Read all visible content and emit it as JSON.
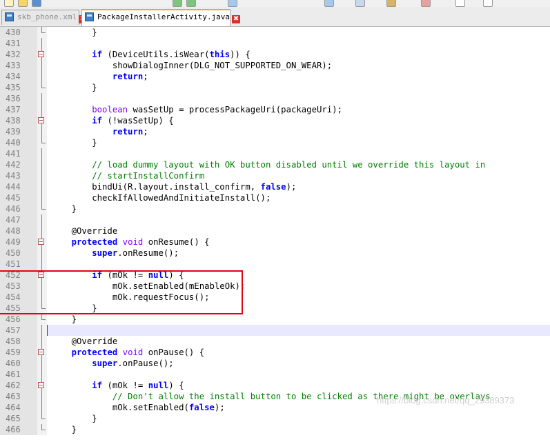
{
  "tabs": [
    {
      "label": "skb_phone.xml",
      "active": false
    },
    {
      "label": "PackageInstallerActivity.java",
      "active": true
    }
  ],
  "close_symbol": "✖",
  "lines": [
    {
      "n": "430",
      "fold": "end",
      "segs": [
        [
          "        }",
          ""
        ]
      ]
    },
    {
      "n": "431",
      "fold": "bar",
      "segs": []
    },
    {
      "n": "432",
      "fold": "open",
      "segs": [
        [
          "        ",
          ""
        ],
        [
          "if",
          "kw"
        ],
        [
          " (DeviceUtils.isWear(",
          ""
        ],
        [
          "this",
          "kw"
        ],
        [
          ")) {",
          ""
        ]
      ]
    },
    {
      "n": "433",
      "fold": "bar",
      "segs": [
        [
          "            showDialogInner(DLG_NOT_SUPPORTED_ON_WEAR);",
          ""
        ]
      ]
    },
    {
      "n": "434",
      "fold": "bar",
      "segs": [
        [
          "            ",
          ""
        ],
        [
          "return",
          "kw"
        ],
        [
          ";",
          ""
        ]
      ]
    },
    {
      "n": "435",
      "fold": "end",
      "segs": [
        [
          "        }",
          ""
        ]
      ]
    },
    {
      "n": "436",
      "fold": "bar",
      "segs": []
    },
    {
      "n": "437",
      "fold": "bar",
      "segs": [
        [
          "        ",
          ""
        ],
        [
          "boolean",
          "ty"
        ],
        [
          " wasSetUp = processPackageUri(packageUri);",
          ""
        ]
      ]
    },
    {
      "n": "438",
      "fold": "open",
      "segs": [
        [
          "        ",
          ""
        ],
        [
          "if",
          "kw"
        ],
        [
          " (!wasSetUp) {",
          ""
        ]
      ]
    },
    {
      "n": "439",
      "fold": "bar",
      "segs": [
        [
          "            ",
          ""
        ],
        [
          "return",
          "kw"
        ],
        [
          ";",
          ""
        ]
      ]
    },
    {
      "n": "440",
      "fold": "end",
      "segs": [
        [
          "        }",
          ""
        ]
      ]
    },
    {
      "n": "441",
      "fold": "bar",
      "segs": []
    },
    {
      "n": "442",
      "fold": "bar",
      "segs": [
        [
          "        // load dummy layout with OK button disabled until we override this layout in",
          "cm"
        ]
      ]
    },
    {
      "n": "443",
      "fold": "bar",
      "segs": [
        [
          "        // startInstallConfirm",
          "cm"
        ]
      ]
    },
    {
      "n": "444",
      "fold": "bar",
      "segs": [
        [
          "        bindUi(R.layout.install_confirm, ",
          ""
        ],
        [
          "false",
          "kw"
        ],
        [
          ");",
          ""
        ]
      ]
    },
    {
      "n": "445",
      "fold": "bar",
      "segs": [
        [
          "        checkIfAllowedAndInitiateInstall();",
          ""
        ]
      ]
    },
    {
      "n": "446",
      "fold": "end",
      "segs": [
        [
          "    }",
          ""
        ]
      ]
    },
    {
      "n": "447",
      "fold": "bar",
      "segs": []
    },
    {
      "n": "448",
      "fold": "bar",
      "segs": [
        [
          "    @Override",
          ""
        ]
      ]
    },
    {
      "n": "449",
      "fold": "open",
      "segs": [
        [
          "    ",
          ""
        ],
        [
          "protected",
          "kw"
        ],
        [
          " ",
          ""
        ],
        [
          "void",
          "ty"
        ],
        [
          " onResume() {",
          ""
        ]
      ]
    },
    {
      "n": "450",
      "fold": "bar",
      "segs": [
        [
          "        ",
          ""
        ],
        [
          "super",
          "kw"
        ],
        [
          ".onResume();",
          ""
        ]
      ]
    },
    {
      "n": "451",
      "fold": "bar",
      "segs": []
    },
    {
      "n": "452",
      "fold": "open",
      "segs": [
        [
          "        ",
          ""
        ],
        [
          "if",
          "kw"
        ],
        [
          " (mOk != ",
          ""
        ],
        [
          "null",
          "kw"
        ],
        [
          ") {",
          ""
        ]
      ]
    },
    {
      "n": "453",
      "fold": "bar",
      "segs": [
        [
          "            mOk.setEnabled(mEnableOk);",
          ""
        ]
      ]
    },
    {
      "n": "454",
      "fold": "bar",
      "segs": [
        [
          "            mOk.requestFocus();",
          ""
        ]
      ]
    },
    {
      "n": "455",
      "fold": "end",
      "segs": [
        [
          "        }",
          ""
        ]
      ]
    },
    {
      "n": "456",
      "fold": "end",
      "segs": [
        [
          "    }",
          ""
        ]
      ]
    },
    {
      "n": "457",
      "fold": "bar",
      "segs": [],
      "current": true
    },
    {
      "n": "458",
      "fold": "bar",
      "segs": [
        [
          "    @Override",
          ""
        ]
      ]
    },
    {
      "n": "459",
      "fold": "open",
      "segs": [
        [
          "    ",
          ""
        ],
        [
          "protected",
          "kw"
        ],
        [
          " ",
          ""
        ],
        [
          "void",
          "ty"
        ],
        [
          " onPause() {",
          ""
        ]
      ]
    },
    {
      "n": "460",
      "fold": "bar",
      "segs": [
        [
          "        ",
          ""
        ],
        [
          "super",
          "kw"
        ],
        [
          ".onPause();",
          ""
        ]
      ]
    },
    {
      "n": "461",
      "fold": "bar",
      "segs": []
    },
    {
      "n": "462",
      "fold": "open",
      "segs": [
        [
          "        ",
          ""
        ],
        [
          "if",
          "kw"
        ],
        [
          " (mOk != ",
          ""
        ],
        [
          "null",
          "kw"
        ],
        [
          ") {",
          ""
        ]
      ]
    },
    {
      "n": "463",
      "fold": "bar",
      "segs": [
        [
          "            // Don't allow the install button to be clicked as there might be overlays",
          "cm"
        ]
      ]
    },
    {
      "n": "464",
      "fold": "bar",
      "segs": [
        [
          "            mOk.setEnabled(",
          ""
        ],
        [
          "false",
          "kw"
        ],
        [
          ");",
          ""
        ]
      ]
    },
    {
      "n": "465",
      "fold": "end",
      "segs": [
        [
          "        }",
          ""
        ]
      ]
    },
    {
      "n": "466",
      "fold": "end",
      "segs": [
        [
          "    }",
          ""
        ]
      ]
    }
  ],
  "watermark": "https://blog.csdn.net/qq_29389373",
  "colors": {
    "keyword": "#0000ff",
    "type": "#8000ff",
    "comment": "#008000",
    "highlight_box": "#e60012",
    "gutter": "#e4e4e4"
  }
}
